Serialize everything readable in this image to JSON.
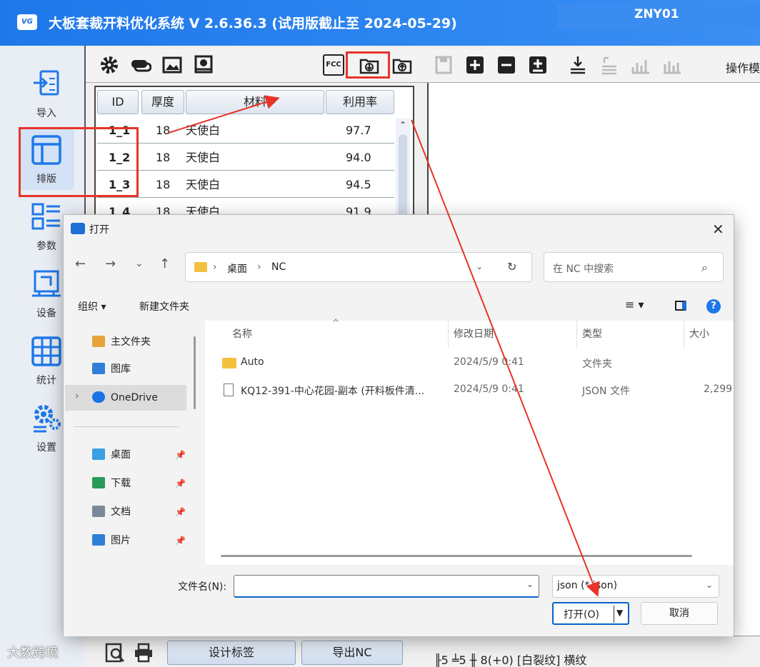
{
  "app": {
    "title": "大板套裁开料优化系统  V 2.6.36.3  (试用版截止至 2024-05-29)",
    "user": "ZNY01",
    "logo_text": "VG"
  },
  "sidebar": {
    "items": [
      {
        "label": "导入",
        "icon": "import-icon"
      },
      {
        "label": "排版",
        "icon": "layout-icon"
      },
      {
        "label": "参数",
        "icon": "parameters-icon"
      },
      {
        "label": "设备",
        "icon": "device-icon"
      },
      {
        "label": "统计",
        "icon": "statistics-icon"
      },
      {
        "label": "设置",
        "icon": "settings-icon"
      }
    ]
  },
  "toolbar": {
    "fcc_label": "FCC",
    "operation_label": "操作模"
  },
  "table": {
    "headers": [
      "ID",
      "厚度",
      "材料",
      "利用率"
    ],
    "rows": [
      {
        "id": "1_1",
        "thickness": "18",
        "material": "天使白",
        "rate": "97.7"
      },
      {
        "id": "1_2",
        "thickness": "18",
        "material": "天使白",
        "rate": "94.0"
      },
      {
        "id": "1_3",
        "thickness": "18",
        "material": "天使白",
        "rate": "94.5"
      },
      {
        "id": "1_4",
        "thickness": "18",
        "material": "天使白",
        "rate": "91.9"
      }
    ]
  },
  "bottom": {
    "design_label": "设计标签",
    "export_label": "导出NC",
    "status": "╟5 ╧5  ╫ 8(+0)   [白裂纹]  横纹",
    "watermark": "大数跨境"
  },
  "dialog": {
    "title": "打开",
    "path": [
      "桌面",
      "NC"
    ],
    "search_placeholder": "在 NC 中搜索",
    "organize": "组织 ▾",
    "new_folder": "新建文件夹",
    "nav_items": [
      {
        "label": "主文件夹",
        "icon": "home-icon",
        "color": "#e8a23a"
      },
      {
        "label": "图库",
        "icon": "gallery-icon",
        "color": "#2f7fd8"
      },
      {
        "label": "OneDrive",
        "icon": "cloud-icon",
        "color": "#1a73e8"
      },
      {
        "label": "桌面",
        "icon": "desktop-icon",
        "color": "#3aa0e0"
      },
      {
        "label": "下载",
        "icon": "download-icon",
        "color": "#2a9a5a"
      },
      {
        "label": "文档",
        "icon": "document-icon",
        "color": "#7a8a9a"
      },
      {
        "label": "图片",
        "icon": "picture-icon",
        "color": "#2f7fd8"
      }
    ],
    "columns": [
      "名称",
      "修改日期",
      "类型",
      "大小"
    ],
    "files": [
      {
        "name": "Auto",
        "date": "2024/5/9 0:41",
        "type": "文件夹",
        "size": "",
        "icon": "folder-icon"
      },
      {
        "name": "KQ12-391-中心花园-副本 (开料板件清...",
        "date": "2024/5/9 0:41",
        "type": "JSON 文件",
        "size": "2,299",
        "icon": "file-icon"
      }
    ],
    "filename_label": "文件名(N):",
    "filename_value": "",
    "filetype": "json (*.json)",
    "open_label": "打开(O)",
    "cancel_label": "取消"
  },
  "colors": {
    "accent": "#1f78ea",
    "highlight": "#e8342a",
    "primary_button_border": "#0a62c9"
  }
}
